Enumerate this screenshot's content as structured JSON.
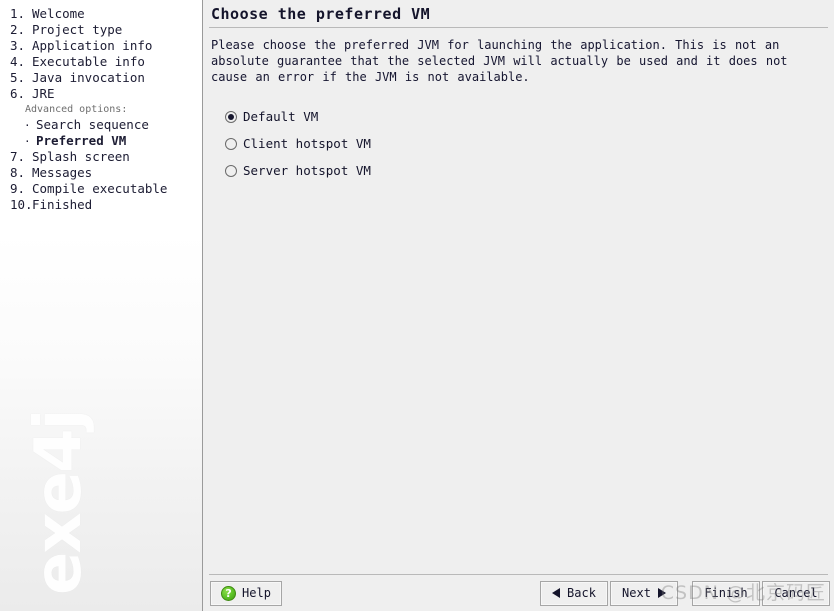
{
  "sidebar": {
    "steps": [
      {
        "num": "1.",
        "label": "Welcome"
      },
      {
        "num": "2.",
        "label": "Project type"
      },
      {
        "num": "3.",
        "label": "Application info"
      },
      {
        "num": "4.",
        "label": "Executable info"
      },
      {
        "num": "5.",
        "label": "Java invocation"
      },
      {
        "num": "6.",
        "label": "JRE"
      }
    ],
    "advanced_header": "Advanced options:",
    "substeps": [
      {
        "bullet": "·",
        "label": "Search sequence",
        "current": false
      },
      {
        "bullet": "·",
        "label": "Preferred VM",
        "current": true
      }
    ],
    "steps_after": [
      {
        "num": "7.",
        "label": "Splash screen"
      },
      {
        "num": "8.",
        "label": "Messages"
      },
      {
        "num": "9.",
        "label": "Compile executable"
      },
      {
        "num": "10.",
        "label": "Finished"
      }
    ],
    "logo_text": "exe4j"
  },
  "main": {
    "title": "Choose the preferred VM",
    "description": "Please choose the preferred JVM for launching the application. This is not an absolute guarantee that the selected JVM will actually be used and it does not cause an error if the JVM is not available.",
    "vm_options": [
      {
        "label": "Default VM",
        "selected": true
      },
      {
        "label": "Client hotspot VM",
        "selected": false
      },
      {
        "label": "Server hotspot VM",
        "selected": false
      }
    ]
  },
  "buttons": {
    "help": "Help",
    "help_icon_glyph": "?",
    "back": "Back",
    "next": "Next",
    "finish": "Finish",
    "cancel": "Cancel"
  },
  "watermark": {
    "text": "CSDN @北京码匠"
  },
  "colors": {
    "panel_background": "#efefef",
    "sidebar_background": "#ffffff",
    "text": "#14142b",
    "muted_text": "#6e6e6e",
    "divider": "#b9b9b9",
    "help_icon_green": "#63c72b"
  }
}
